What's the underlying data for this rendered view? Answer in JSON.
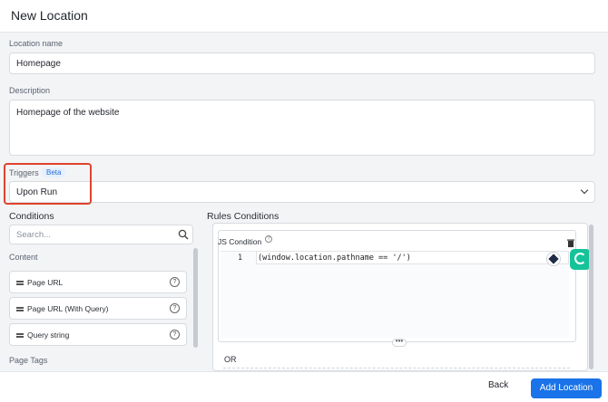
{
  "header": {
    "title": "New Location"
  },
  "form": {
    "name_label": "Location name",
    "name_value": "Homepage",
    "description_label": "Description",
    "description_value": "Homepage of the website",
    "triggers_label": "Triggers",
    "triggers_badge": "Beta",
    "triggers_value": "Upon Run"
  },
  "conditions": {
    "title": "Conditions",
    "search_placeholder": "Search...",
    "group_content": "Content",
    "items": [
      {
        "label": "Page URL"
      },
      {
        "label": "Page URL (With Query)"
      },
      {
        "label": "Query string"
      }
    ],
    "group_page_tags": "Page Tags"
  },
  "rules": {
    "title": "Rules Conditions",
    "js_label": "JS Condition",
    "line_number": "1",
    "code": "(window.location.pathname == '/')",
    "or_label": "OR"
  },
  "footer": {
    "back_label": "Back",
    "add_label": "Add Location"
  },
  "colors": {
    "accent": "#1a73e8",
    "highlight": "#e0432e",
    "grammarly": "#15c39a"
  }
}
